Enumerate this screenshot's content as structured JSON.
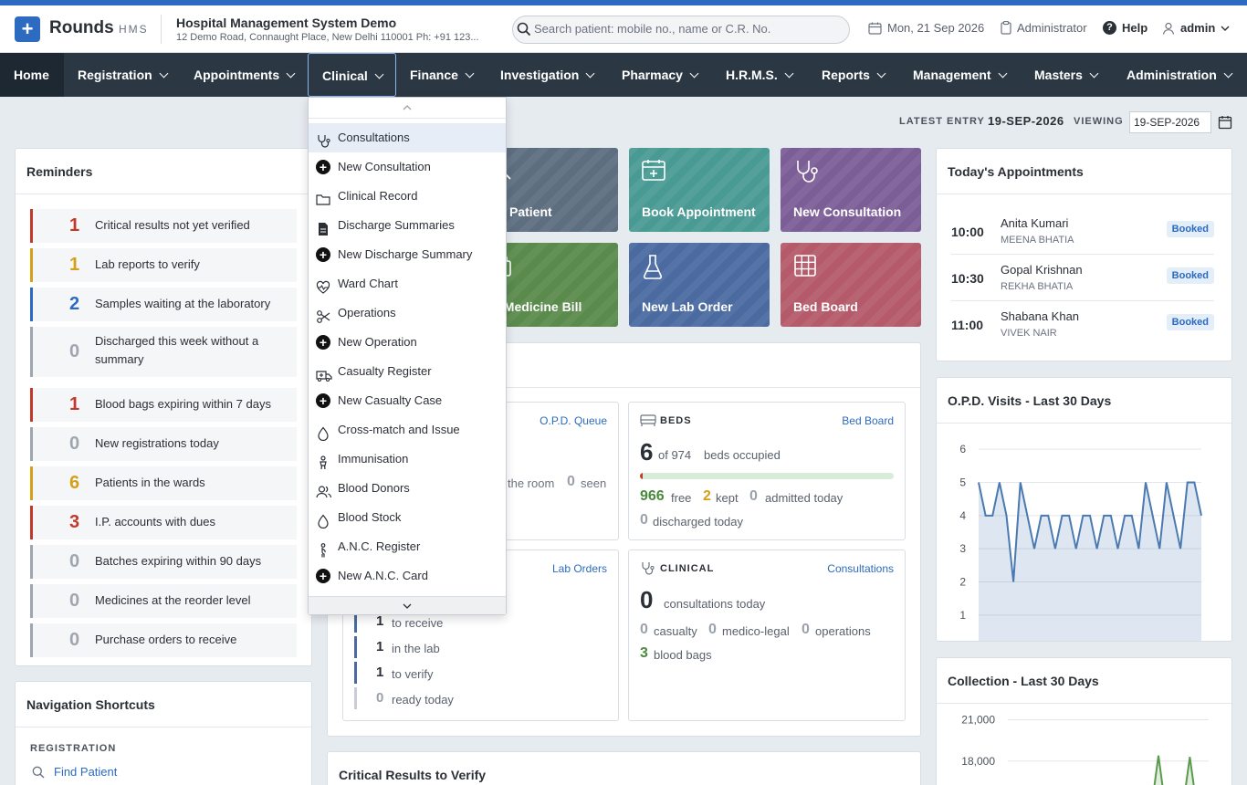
{
  "brand": {
    "name": "Rounds",
    "suffix": "HMS",
    "logo_glyph": "+"
  },
  "hospital": {
    "name": "Hospital Management System Demo",
    "address": "12 Demo Road, Connaught Place, New Delhi 110001 Ph: +91 123..."
  },
  "search": {
    "placeholder": "Search patient: mobile no., name or C.R. No."
  },
  "header": {
    "date": "Mon, 21 Sep 2026",
    "role": "Administrator",
    "help": "Help",
    "user": "admin"
  },
  "nav": {
    "items": [
      "Home",
      "Registration",
      "Appointments",
      "Clinical",
      "Finance",
      "Investigation",
      "Pharmacy",
      "H.R.M.S.",
      "Reports",
      "Management",
      "Masters",
      "Administration"
    ],
    "active": "Clinical"
  },
  "entry": {
    "latest_label": "LATEST ENTRY",
    "latest_value": "19-SEP-2026",
    "viewing_label": "VIEWING",
    "viewing_value": "19-SEP-2026"
  },
  "reminders": {
    "title": "Reminders",
    "items": [
      {
        "count": "1",
        "text": "Critical results not yet verified",
        "color": "#c0392b"
      },
      {
        "count": "1",
        "text": "Lab reports to verify",
        "color": "#d4a017"
      },
      {
        "count": "2",
        "text": "Samples waiting at the laboratory",
        "color": "#2c6bc0"
      },
      {
        "count": "0",
        "text": "Discharged this week without a summary",
        "color": "#a0a6af"
      },
      {
        "count": "1",
        "text": "Blood bags expiring within 7 days",
        "color": "#c0392b"
      },
      {
        "count": "0",
        "text": "New registrations today",
        "color": "#a0a6af"
      },
      {
        "count": "6",
        "text": "Patients in the wards",
        "color": "#d4a017"
      },
      {
        "count": "3",
        "text": "I.P. accounts with dues",
        "color": "#c0392b"
      },
      {
        "count": "0",
        "text": "Batches expiring within 90 days",
        "color": "#a0a6af"
      },
      {
        "count": "0",
        "text": "Medicines at the reorder level",
        "color": "#a0a6af"
      },
      {
        "count": "0",
        "text": "Purchase orders to receive",
        "color": "#a0a6af"
      }
    ]
  },
  "shortcuts": {
    "title": "Navigation Shortcuts",
    "section": "REGISTRATION",
    "first": "Find Patient"
  },
  "tiles": [
    {
      "label": "Find Patient",
      "visible": "nd Patient",
      "color": "#5d6e80"
    },
    {
      "label": "Book Appointment",
      "color": "#4a9a94"
    },
    {
      "label": "New Consultation",
      "color": "#7c5e96"
    },
    {
      "label": "New Medicine Bill",
      "visible": "w Medicine Bill",
      "color": "#5a8a4c"
    },
    {
      "label": "New Lab Order",
      "color": "#4a6aa0"
    },
    {
      "label": "Bed Board",
      "color": "#b45a6a"
    }
  ],
  "opd_card": {
    "link": "O.P.D. Queue",
    "in_room_text": "the room",
    "seen_count": "0",
    "seen_label": "seen"
  },
  "beds": {
    "caption": "BEDS",
    "link": "Bed Board",
    "occupied": "6",
    "of_text": "of 974",
    "occupied_label": "beds occupied",
    "occupied_fraction": 0.006,
    "free": "966",
    "free_label": "free",
    "kept": "2",
    "kept_label": "kept",
    "admitted": "0",
    "admitted_label": "admitted today",
    "discharged": "0",
    "discharged_label": "discharged today"
  },
  "lab": {
    "link": "Lab Orders",
    "rows": [
      {
        "count": "1",
        "label": "to receive",
        "color": "#4a6aa0"
      },
      {
        "count": "1",
        "label": "in the lab",
        "color": "#4a6aa0"
      },
      {
        "count": "1",
        "label": "to verify",
        "color": "#4a6aa0"
      },
      {
        "count": "0",
        "label": "ready today",
        "color": "#c9ced6"
      }
    ]
  },
  "clinical": {
    "caption": "CLINICAL",
    "link": "Consultations",
    "consults": "0",
    "consults_label": "consultations today",
    "casualty": "0",
    "casualty_label": "casualty",
    "medicolegal": "0",
    "medicolegal_label": "medico-legal",
    "operations": "0",
    "operations_label": "operations",
    "bloodbags": "3",
    "bloodbags_label": "blood bags"
  },
  "critical": {
    "title": "Critical Results to Verify"
  },
  "appointments": {
    "title": "Today's Appointments",
    "items": [
      {
        "time": "10:00",
        "patient": "Anita Kumari",
        "doctor": "MEENA BHATIA",
        "status": "Booked"
      },
      {
        "time": "10:30",
        "patient": "Gopal Krishnan",
        "doctor": "REKHA BHATIA",
        "status": "Booked"
      },
      {
        "time": "11:00",
        "patient": "Shabana Khan",
        "doctor": "VIVEK NAIR",
        "status": "Booked"
      }
    ]
  },
  "clinical_menu": {
    "items": [
      {
        "label": "Consultations",
        "icon": "stethoscope-icon"
      },
      {
        "label": "New Consultation",
        "icon": "plus-circle-icon"
      },
      {
        "label": "Clinical Record",
        "icon": "folder-icon"
      },
      {
        "label": "Discharge Summaries",
        "icon": "document-icon"
      },
      {
        "label": "New Discharge Summary",
        "icon": "plus-circle-icon"
      },
      {
        "label": "Ward Chart",
        "icon": "heartbeat-icon"
      },
      {
        "label": "Operations",
        "icon": "scissors-icon"
      },
      {
        "label": "New Operation",
        "icon": "plus-circle-icon"
      },
      {
        "label": "Casualty Register",
        "icon": "ambulance-icon"
      },
      {
        "label": "New Casualty Case",
        "icon": "plus-circle-icon"
      },
      {
        "label": "Cross-match and Issue",
        "icon": "drop-icon"
      },
      {
        "label": "Immunisation",
        "icon": "baby-icon"
      },
      {
        "label": "Blood Donors",
        "icon": "users-icon"
      },
      {
        "label": "Blood Stock",
        "icon": "drop-icon"
      },
      {
        "label": "A.N.C. Register",
        "icon": "pregnant-icon"
      },
      {
        "label": "New A.N.C. Card",
        "icon": "plus-circle-icon"
      }
    ]
  },
  "chart_data": [
    {
      "type": "area",
      "title": "O.P.D. Visits - Last 30 Days",
      "xlabel": "",
      "ylabel": "",
      "yticks": [
        1,
        2,
        3,
        4,
        5,
        6
      ],
      "ylim": [
        0.5,
        6.5
      ],
      "grid": true,
      "color": "#4a7ab0",
      "series": [
        {
          "values": [
            5,
            4,
            4,
            5,
            4,
            2,
            5,
            4,
            3,
            4,
            4,
            3,
            4,
            4,
            3,
            4,
            4,
            3,
            4,
            4,
            3,
            4,
            4,
            3,
            5,
            4,
            3,
            5,
            4,
            3,
            5,
            5,
            4
          ]
        }
      ]
    },
    {
      "type": "area",
      "title": "Collection - Last 30 Days",
      "xlabel": "",
      "ylabel": "",
      "yticks": [
        18000,
        21000
      ],
      "ytick_labels": [
        "18,000",
        "21,000"
      ],
      "ylim": [
        15000,
        21500
      ],
      "grid": true,
      "color": "#5a9a4c",
      "series": [
        {
          "values": [
            0,
            0,
            0,
            0,
            0,
            0,
            0,
            0,
            0,
            0,
            0,
            0,
            0,
            0,
            0,
            0,
            0,
            0,
            0,
            0,
            0,
            0,
            0,
            0,
            18400,
            0,
            0,
            0,
            0,
            18300,
            0,
            0,
            0
          ]
        }
      ]
    }
  ]
}
